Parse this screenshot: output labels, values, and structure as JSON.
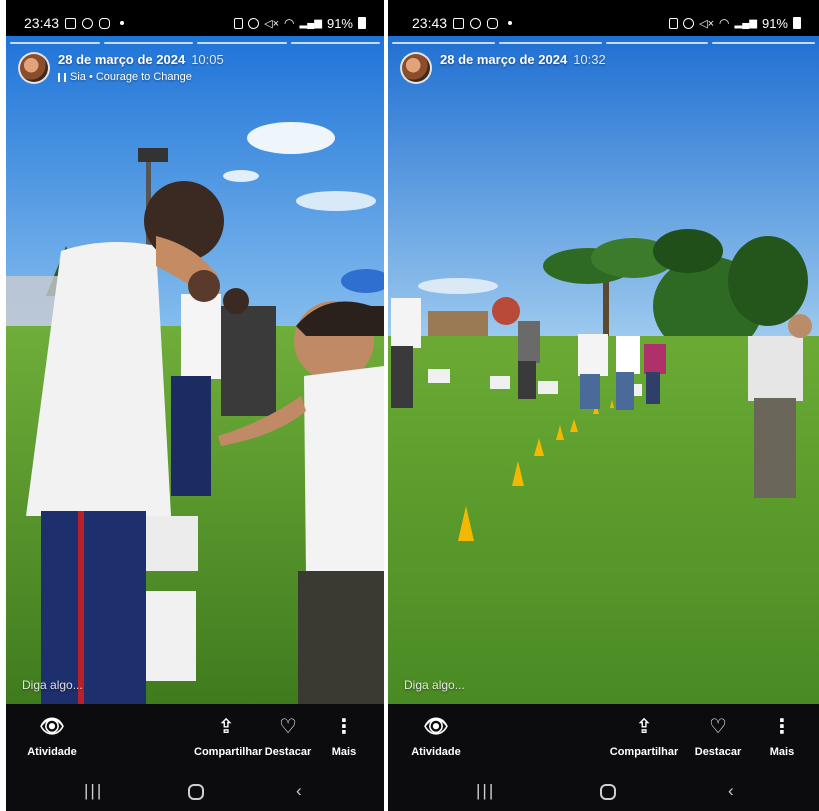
{
  "screens": [
    {
      "status_bar": {
        "time": "23:43",
        "battery": "91%"
      },
      "story": {
        "date": "28 de março de 2024",
        "time": "10:05",
        "music": "Sia • Courage to Change",
        "reply_placeholder": "Diga algo..."
      },
      "actions": {
        "activity": "Atividade",
        "share": "Compartilhar",
        "highlight": "Destacar",
        "more": "Mais"
      }
    },
    {
      "status_bar": {
        "time": "23:43",
        "battery": "91%"
      },
      "story": {
        "date": "28 de março de 2024",
        "time": "10:32",
        "reply_placeholder": "Diga algo..."
      },
      "actions": {
        "activity": "Atividade",
        "share": "Compartilhar",
        "highlight": "Destacar",
        "more": "Mais"
      }
    }
  ],
  "icons": {
    "activity": "eye-icon",
    "share": "share-icon",
    "highlight": "heart-circle-icon",
    "more": "more-vertical-icon"
  },
  "colors": {
    "sky": "#3f8fdc",
    "grass": "#5a9a2c",
    "cone": "#f5b800",
    "bar_bg": "#0c0c0e"
  }
}
